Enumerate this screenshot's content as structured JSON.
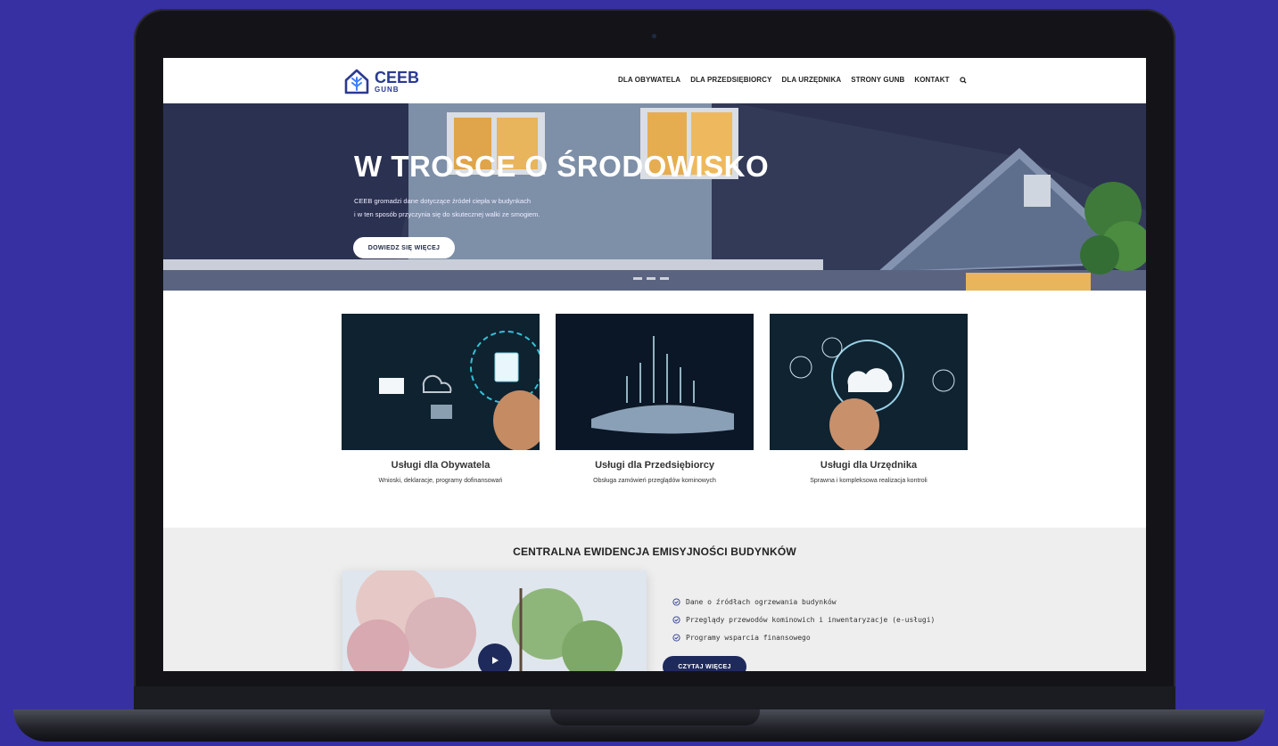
{
  "logo": {
    "name": "CEEB",
    "sub": "GUNB"
  },
  "nav": {
    "items": [
      "DLA OBYWATELA",
      "DLA PRZEDSIĘBIORCY",
      "DLA URZĘDNIKA",
      "STRONY GUNB",
      "KONTAKT"
    ],
    "search_icon": "search-icon"
  },
  "hero": {
    "title": "W TROSCE O ŚRODOWISKO",
    "line1": "CEEB gromadzi dane dotyczące źródeł ciepła w budynkach",
    "line2": "i w ten sposób przyczynia się do skutecznej walki ze smogiem.",
    "button": "DOWIEDZ SIĘ WIĘCEJ"
  },
  "cards": [
    {
      "title": "Usługi dla Obywatela",
      "desc": "Wnioski, deklaracje, programy dofinansowań"
    },
    {
      "title": "Usługi dla Przedsiębiorcy",
      "desc": "Obsługa zamówień przeglądów kominowych"
    },
    {
      "title": "Usługi dla Urzędnika",
      "desc": "Sprawna i kompleksowa realizacja kontroli"
    }
  ],
  "section": {
    "title": "CENTRALNA EWIDENCJA EMISYJNOŚCI BUDYNKÓW",
    "list": [
      "Dane o źródłach ogrzewania budynków",
      "Przeglądy przewodów kominowich i inwentaryzacje (e-usługi)",
      "Programy wsparcia finansowego"
    ],
    "button": "CZYTAJ WIĘCEJ"
  },
  "colors": {
    "background": "#3730a3",
    "brand": "#2b3a91",
    "dark_button": "#1f2a5c"
  }
}
